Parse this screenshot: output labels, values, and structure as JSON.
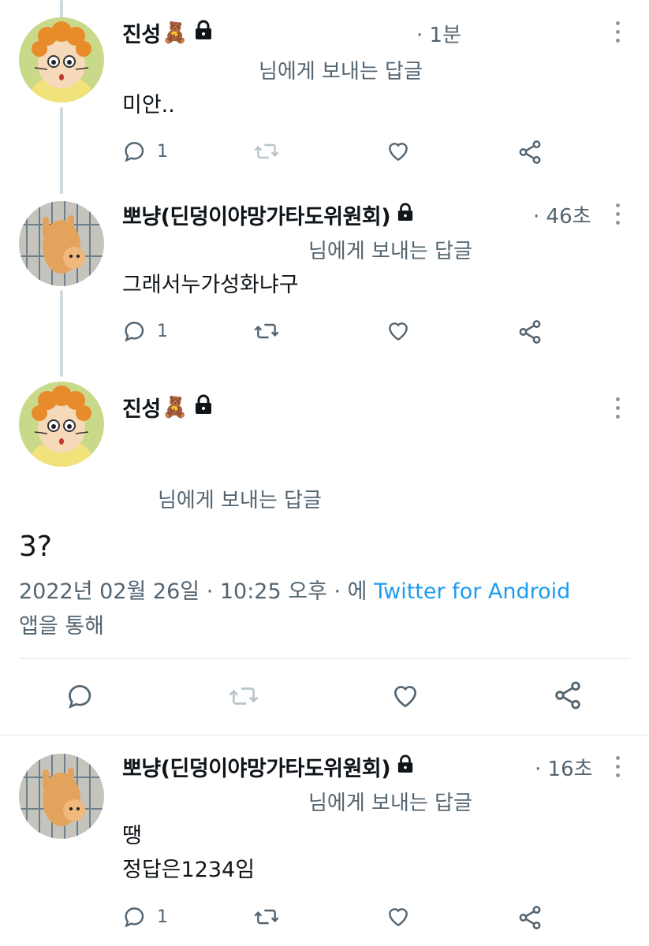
{
  "colors": {
    "accent": "#1d9bf0",
    "muted": "#536471",
    "thread_line": "#cfd9de"
  },
  "tweets": [
    {
      "name": "진성",
      "name_emoji": "🧸",
      "time": "· 1분",
      "reply_to": "님에게 보내는 답글",
      "text": [
        "미안.."
      ],
      "reply_count": "1"
    },
    {
      "name": "뽀냥(딘덩이야망가타도위원회)",
      "time": "· 46초",
      "reply_to": "님에게 보내는 답글",
      "text": [
        "그래서누가성화냐구"
      ],
      "reply_count": "1"
    }
  ],
  "focused": {
    "name": "진성",
    "name_emoji": "🧸",
    "reply_to": "님에게 보내는 답글",
    "text": "3?",
    "meta_date": "2022년 02월 26일 · 10:25 오후 · 에 ",
    "meta_link": "Twitter for Android",
    "meta_suffix": "앱을 통해"
  },
  "reply": {
    "name": "뽀냥(딘덩이야망가타도위원회)",
    "time": "· 16초",
    "reply_to": "님에게 보내는 답글",
    "line1": "땡",
    "line2": "정답은1234임",
    "reply_count": "1"
  }
}
